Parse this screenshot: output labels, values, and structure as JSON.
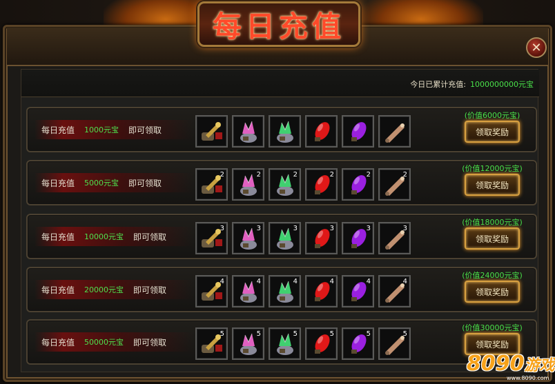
{
  "window": {
    "title": "每日充值",
    "close_glyph": "✕",
    "total_label": "今日已累计充值:",
    "total_amount": "1000000000元宝"
  },
  "rows": [
    {
      "prefix": "每日充值",
      "amount": "1000元宝",
      "suffix": "即可领取",
      "value": "(价值6000元宝)",
      "button": "领取奖励",
      "quantity": ""
    },
    {
      "prefix": "每日充值",
      "amount": "5000元宝",
      "suffix": "即可领取",
      "value": "(价值12000元宝)",
      "button": "领取奖励",
      "quantity": "2"
    },
    {
      "prefix": "每日充值",
      "amount": "10000元宝",
      "suffix": "即可领取",
      "value": "(价值18000元宝)",
      "button": "领取奖励",
      "quantity": "3"
    },
    {
      "prefix": "每日充值",
      "amount": "20000元宝",
      "suffix": "即可领取",
      "value": "(价值24000元宝)",
      "button": "领取奖励",
      "quantity": "4"
    },
    {
      "prefix": "每日充值",
      "amount": "50000元宝",
      "suffix": "即可领取",
      "value": "(价值30000元宝)",
      "button": "领取奖励",
      "quantity": "5"
    }
  ],
  "items": [
    {
      "icon": "gold-key-icon",
      "color": "#c8a040"
    },
    {
      "icon": "pink-crystal-bag-icon",
      "color": "#e060c0"
    },
    {
      "icon": "green-crystal-bag-icon",
      "color": "#40d070"
    },
    {
      "icon": "red-gem-icon",
      "color": "#e01818"
    },
    {
      "icon": "purple-gem-icon",
      "color": "#9a20e0"
    },
    {
      "icon": "scroll-icon",
      "color": "#c09070"
    }
  ],
  "watermark": {
    "logo": "8090",
    "suffix": "游戏",
    "url": "www.8090.com"
  }
}
